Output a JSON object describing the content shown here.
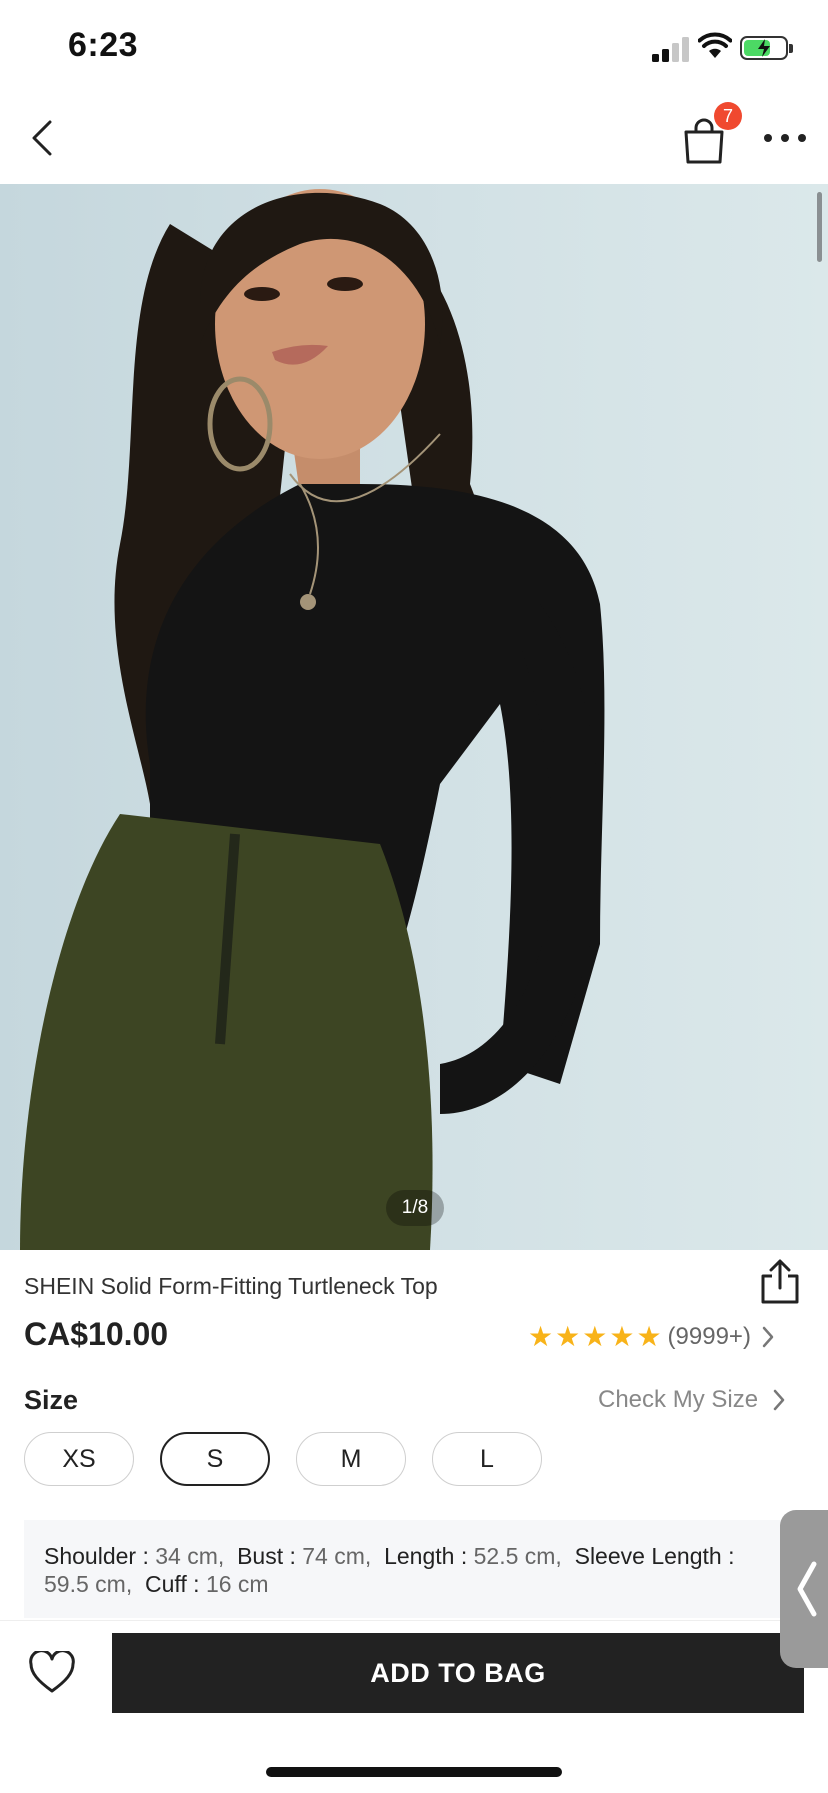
{
  "status_bar": {
    "time": "6:23"
  },
  "nav": {
    "bag_count": "7"
  },
  "product": {
    "image_indicator": "1/8",
    "title": "SHEIN Solid Form-Fitting Turtleneck Top",
    "price": "CA$10.00",
    "rating_stars": 5,
    "rating_count": "(9999+)"
  },
  "size": {
    "label": "Size",
    "check_label": "Check My Size",
    "options": [
      "XS",
      "S",
      "M",
      "L"
    ],
    "selected": "S"
  },
  "measurements": {
    "shoulder_label": "Shoulder :",
    "shoulder_value": "34 cm,",
    "bust_label": "Bust :",
    "bust_value": "74 cm,",
    "length_label": "Length :",
    "length_value": "52.5 cm,",
    "sleeve_label": "Sleeve Length :",
    "sleeve_value": "59.5 cm,",
    "cuff_label": "Cuff :",
    "cuff_value": "16 cm"
  },
  "bottom": {
    "add_to_bag_label": "ADD TO BAG"
  },
  "colors": {
    "accent_badge": "#f0492f",
    "star": "#f8b319",
    "button_dark": "#222222"
  }
}
